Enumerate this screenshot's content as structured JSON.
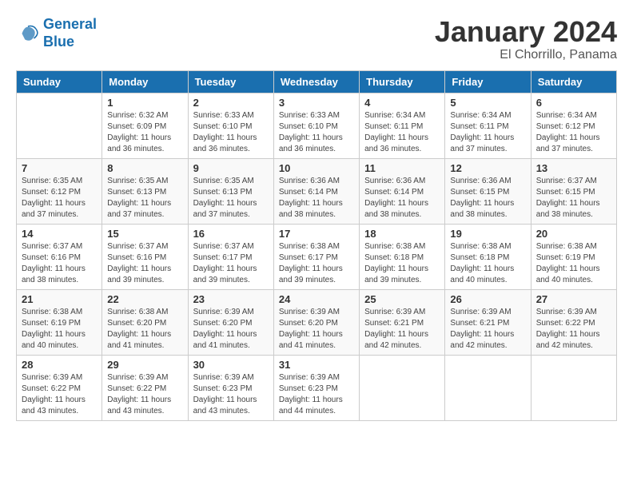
{
  "header": {
    "logo_line1": "General",
    "logo_line2": "Blue",
    "main_title": "January 2024",
    "subtitle": "El Chorrillo, Panama"
  },
  "calendar": {
    "days_of_week": [
      "Sunday",
      "Monday",
      "Tuesday",
      "Wednesday",
      "Thursday",
      "Friday",
      "Saturday"
    ],
    "weeks": [
      [
        {
          "day": "",
          "info": ""
        },
        {
          "day": "1",
          "info": "Sunrise: 6:32 AM\nSunset: 6:09 PM\nDaylight: 11 hours\nand 36 minutes."
        },
        {
          "day": "2",
          "info": "Sunrise: 6:33 AM\nSunset: 6:10 PM\nDaylight: 11 hours\nand 36 minutes."
        },
        {
          "day": "3",
          "info": "Sunrise: 6:33 AM\nSunset: 6:10 PM\nDaylight: 11 hours\nand 36 minutes."
        },
        {
          "day": "4",
          "info": "Sunrise: 6:34 AM\nSunset: 6:11 PM\nDaylight: 11 hours\nand 36 minutes."
        },
        {
          "day": "5",
          "info": "Sunrise: 6:34 AM\nSunset: 6:11 PM\nDaylight: 11 hours\nand 37 minutes."
        },
        {
          "day": "6",
          "info": "Sunrise: 6:34 AM\nSunset: 6:12 PM\nDaylight: 11 hours\nand 37 minutes."
        }
      ],
      [
        {
          "day": "7",
          "info": "Sunrise: 6:35 AM\nSunset: 6:12 PM\nDaylight: 11 hours\nand 37 minutes."
        },
        {
          "day": "8",
          "info": "Sunrise: 6:35 AM\nSunset: 6:13 PM\nDaylight: 11 hours\nand 37 minutes."
        },
        {
          "day": "9",
          "info": "Sunrise: 6:35 AM\nSunset: 6:13 PM\nDaylight: 11 hours\nand 37 minutes."
        },
        {
          "day": "10",
          "info": "Sunrise: 6:36 AM\nSunset: 6:14 PM\nDaylight: 11 hours\nand 38 minutes."
        },
        {
          "day": "11",
          "info": "Sunrise: 6:36 AM\nSunset: 6:14 PM\nDaylight: 11 hours\nand 38 minutes."
        },
        {
          "day": "12",
          "info": "Sunrise: 6:36 AM\nSunset: 6:15 PM\nDaylight: 11 hours\nand 38 minutes."
        },
        {
          "day": "13",
          "info": "Sunrise: 6:37 AM\nSunset: 6:15 PM\nDaylight: 11 hours\nand 38 minutes."
        }
      ],
      [
        {
          "day": "14",
          "info": "Sunrise: 6:37 AM\nSunset: 6:16 PM\nDaylight: 11 hours\nand 38 minutes."
        },
        {
          "day": "15",
          "info": "Sunrise: 6:37 AM\nSunset: 6:16 PM\nDaylight: 11 hours\nand 39 minutes."
        },
        {
          "day": "16",
          "info": "Sunrise: 6:37 AM\nSunset: 6:17 PM\nDaylight: 11 hours\nand 39 minutes."
        },
        {
          "day": "17",
          "info": "Sunrise: 6:38 AM\nSunset: 6:17 PM\nDaylight: 11 hours\nand 39 minutes."
        },
        {
          "day": "18",
          "info": "Sunrise: 6:38 AM\nSunset: 6:18 PM\nDaylight: 11 hours\nand 39 minutes."
        },
        {
          "day": "19",
          "info": "Sunrise: 6:38 AM\nSunset: 6:18 PM\nDaylight: 11 hours\nand 40 minutes."
        },
        {
          "day": "20",
          "info": "Sunrise: 6:38 AM\nSunset: 6:19 PM\nDaylight: 11 hours\nand 40 minutes."
        }
      ],
      [
        {
          "day": "21",
          "info": "Sunrise: 6:38 AM\nSunset: 6:19 PM\nDaylight: 11 hours\nand 40 minutes."
        },
        {
          "day": "22",
          "info": "Sunrise: 6:38 AM\nSunset: 6:20 PM\nDaylight: 11 hours\nand 41 minutes."
        },
        {
          "day": "23",
          "info": "Sunrise: 6:39 AM\nSunset: 6:20 PM\nDaylight: 11 hours\nand 41 minutes."
        },
        {
          "day": "24",
          "info": "Sunrise: 6:39 AM\nSunset: 6:20 PM\nDaylight: 11 hours\nand 41 minutes."
        },
        {
          "day": "25",
          "info": "Sunrise: 6:39 AM\nSunset: 6:21 PM\nDaylight: 11 hours\nand 42 minutes."
        },
        {
          "day": "26",
          "info": "Sunrise: 6:39 AM\nSunset: 6:21 PM\nDaylight: 11 hours\nand 42 minutes."
        },
        {
          "day": "27",
          "info": "Sunrise: 6:39 AM\nSunset: 6:22 PM\nDaylight: 11 hours\nand 42 minutes."
        }
      ],
      [
        {
          "day": "28",
          "info": "Sunrise: 6:39 AM\nSunset: 6:22 PM\nDaylight: 11 hours\nand 43 minutes."
        },
        {
          "day": "29",
          "info": "Sunrise: 6:39 AM\nSunset: 6:22 PM\nDaylight: 11 hours\nand 43 minutes."
        },
        {
          "day": "30",
          "info": "Sunrise: 6:39 AM\nSunset: 6:23 PM\nDaylight: 11 hours\nand 43 minutes."
        },
        {
          "day": "31",
          "info": "Sunrise: 6:39 AM\nSunset: 6:23 PM\nDaylight: 11 hours\nand 44 minutes."
        },
        {
          "day": "",
          "info": ""
        },
        {
          "day": "",
          "info": ""
        },
        {
          "day": "",
          "info": ""
        }
      ]
    ]
  }
}
